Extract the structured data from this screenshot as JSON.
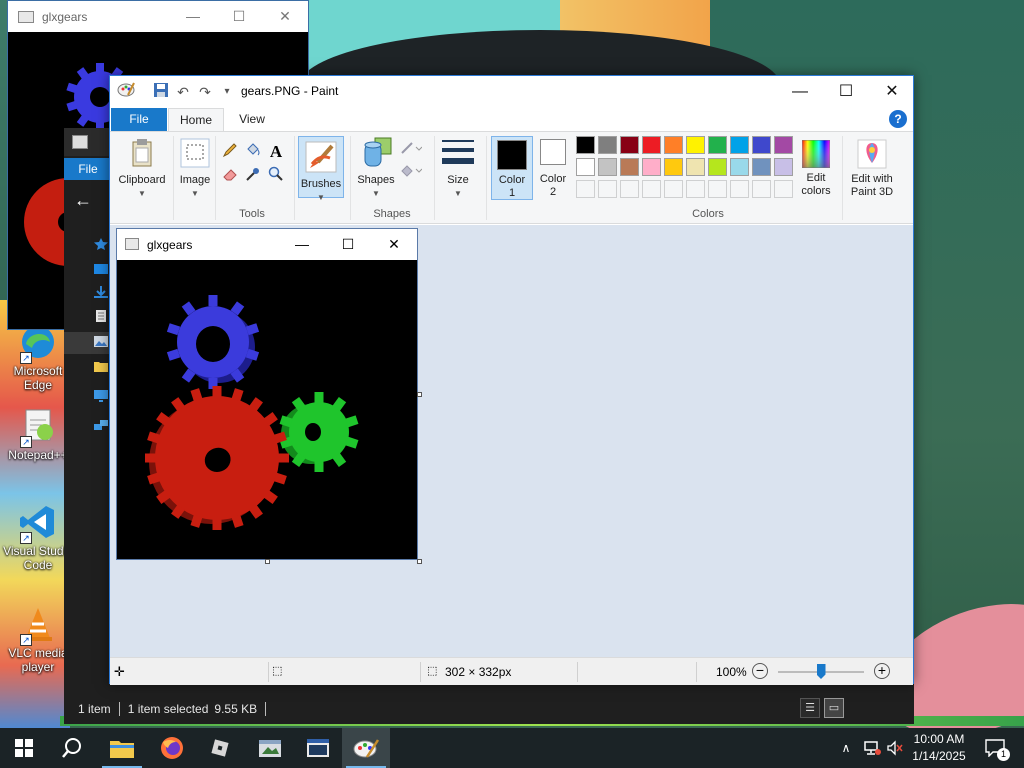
{
  "desktop": {
    "icons": [
      {
        "label": "Microsoft Edge"
      },
      {
        "label": "Notepad++"
      },
      {
        "label": "Visual Studio Code"
      },
      {
        "label": "VLC media player"
      }
    ]
  },
  "background_glx_window": {
    "title": "glxgears",
    "controls": {
      "minimize": "—",
      "maximize": "☐",
      "close": "✕"
    }
  },
  "explorer": {
    "file_tab": "File",
    "back_icon": "←",
    "status": {
      "item_count": "1 item",
      "selection": "1 item selected",
      "size": "9.55 KB"
    }
  },
  "paint": {
    "title": "gears.PNG - Paint",
    "window_controls": {
      "minimize": "—",
      "maximize": "☐",
      "close": "✕"
    },
    "tabs": {
      "file": "File",
      "home": "Home",
      "view": "View"
    },
    "help": "?",
    "ribbon": {
      "clipboard": "Clipboard",
      "image": "Image",
      "tools_group": "Tools",
      "brushes": "Brushes",
      "shapes": "Shapes",
      "shapes_group": "Shapes",
      "size": "Size",
      "color1_line1": "Color",
      "color1_line2": "1",
      "color2_line1": "Color",
      "color2_line2": "2",
      "colors_group": "Colors",
      "edit_colors_line1": "Edit",
      "edit_colors_line2": "colors",
      "edit_paint3d_line1": "Edit with",
      "edit_paint3d_line2": "Paint 3D",
      "color1_value": "#000000",
      "color2_value": "#ffffff"
    },
    "palette": {
      "row1": [
        "#000000",
        "#7f7f7f",
        "#880015",
        "#ed1c24",
        "#ff7f27",
        "#fff200",
        "#22b14c",
        "#00a2e8",
        "#3f48cc",
        "#a349a4"
      ],
      "row2": [
        "#ffffff",
        "#c3c3c3",
        "#b97a57",
        "#ffaec9",
        "#ffc90e",
        "#efe4b0",
        "#b5e61d",
        "#99d9ea",
        "#7092be",
        "#c8bfe7"
      ]
    },
    "canvas_glx": {
      "title": "glxgears",
      "controls": {
        "minimize": "—",
        "maximize": "☐",
        "close": "✕"
      }
    },
    "status": {
      "dimensions": "302 × 332px",
      "zoom": "100%",
      "zoom_fraction": 0.5
    }
  },
  "taskbar": {
    "time": "10:00 AM",
    "date": "1/14/2025",
    "notification_count": "1"
  }
}
